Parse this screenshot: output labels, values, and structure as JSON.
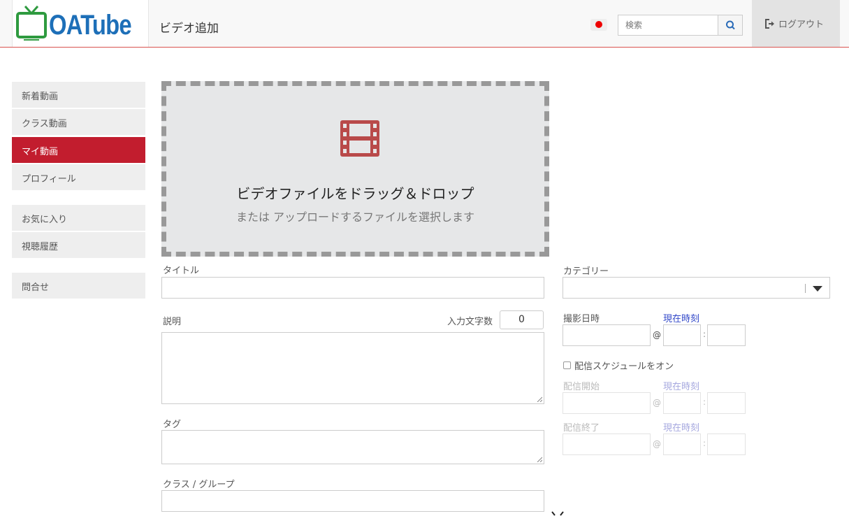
{
  "header": {
    "logo_text": "OATube",
    "page_title": "ビデオ追加",
    "search_placeholder": "検索",
    "logout_label": "ログアウト"
  },
  "sidebar": {
    "items": [
      {
        "label": "新着動画",
        "active": false
      },
      {
        "label": "クラス動画",
        "active": false
      },
      {
        "label": "マイ動画",
        "active": true
      },
      {
        "label": "プロフィール",
        "active": false
      },
      {
        "label": "お気に入り",
        "active": false
      },
      {
        "label": "視聴履歴",
        "active": false
      },
      {
        "label": "問合せ",
        "active": false
      }
    ]
  },
  "dropzone": {
    "title": "ビデオファイルをドラッグ＆ドロップ",
    "subtitle": "または アップロードするファイルを選択します"
  },
  "form": {
    "title_label": "タイトル",
    "description_label": "説明",
    "char_count_label": "入力文字数",
    "char_count_value": "0",
    "tags_label": "タグ",
    "class_group_label": "クラス / グループ",
    "category_label": "カテゴリー",
    "shooting_datetime_label": "撮影日時",
    "current_time_link": "現在時刻",
    "schedule_checkbox_label": "配信スケジュールをオン",
    "schedule_start_label": "配信開始",
    "schedule_end_label": "配信終了",
    "at_symbol": "@",
    "time_separator": ":"
  },
  "colors": {
    "accent_red": "#c21d2e",
    "logo_blue": "#1d6fb8",
    "logo_green": "#2e9a3f",
    "link_blue": "#3349c9"
  }
}
